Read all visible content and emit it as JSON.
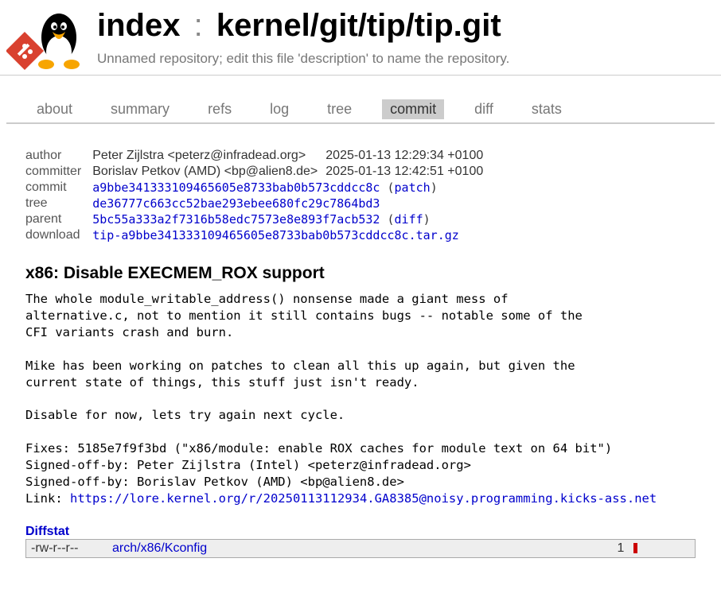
{
  "header": {
    "index_label": "index",
    "sep": ":",
    "repo": "kernel/git/tip/tip.git",
    "desc": "Unnamed repository; edit this file 'description' to name the repository."
  },
  "tabs": [
    {
      "id": "about",
      "label": "about"
    },
    {
      "id": "summary",
      "label": "summary"
    },
    {
      "id": "refs",
      "label": "refs"
    },
    {
      "id": "log",
      "label": "log"
    },
    {
      "id": "tree",
      "label": "tree"
    },
    {
      "id": "commit",
      "label": "commit"
    },
    {
      "id": "diff",
      "label": "diff"
    },
    {
      "id": "stats",
      "label": "stats"
    }
  ],
  "active_tab": "commit",
  "info": {
    "author_label": "author",
    "author": "Peter Zijlstra <peterz@infradead.org>",
    "author_date": "2025-01-13 12:29:34 +0100",
    "committer_label": "committer",
    "committer": "Borislav Petkov (AMD) <bp@alien8.de>",
    "committer_date": "2025-01-13 12:42:51 +0100",
    "commit_label": "commit",
    "commit_sha": "a9bbe341333109465605e8733bab0b573cddcc8c",
    "patch_label": "patch",
    "tree_label": "tree",
    "tree_sha": "de36777c663cc52bae293ebee680fc29c7864bd3",
    "parent_label": "parent",
    "parent_sha": "5bc55a333a2f7316b58edc7573e8e893f7acb532",
    "diff_label": "diff",
    "download_label": "download",
    "download_file": "tip-a9bbe341333109465605e8733bab0b573cddcc8c.tar.gz"
  },
  "subject": "x86: Disable EXECMEM_ROX support",
  "msg_pre": "The whole module_writable_address() nonsense made a giant mess of\nalternative.c, not to mention it still contains bugs -- notable some of the\nCFI variants crash and burn.\n\nMike has been working on patches to clean all this up again, but given the\ncurrent state of things, this stuff just isn't ready.\n\nDisable for now, lets try again next cycle.\n\nFixes: 5185e7f9f3bd (\"x86/module: enable ROX caches for module text on 64 bit\")\nSigned-off-by: Peter Zijlstra (Intel) <peterz@infradead.org>\nSigned-off-by: Borislav Petkov (AMD) <bp@alien8.de>\nLink: ",
  "msg_link": "https://lore.kernel.org/r/20250113112934.GA8385@noisy.programming.kicks-ass.net",
  "diffstat": {
    "heading": "Diffstat",
    "mode": "-rw-r--r--",
    "file": "arch/x86/Kconfig",
    "total": "1"
  }
}
